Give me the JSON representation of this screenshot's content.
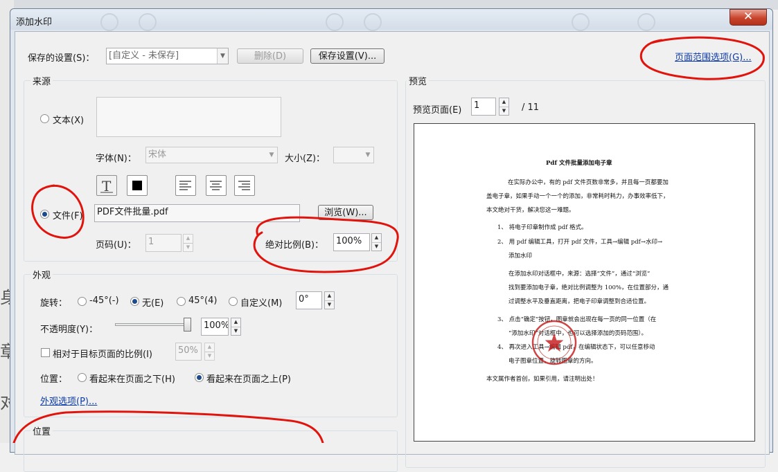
{
  "window": {
    "title": "添加水印",
    "close_label": "✕"
  },
  "background_chars": [
    "身",
    "章",
    "对"
  ],
  "saved_settings": {
    "label": "保存的设置(S)：",
    "value": "[自定义 - 未保存]",
    "delete_label": "删除(D)",
    "save_label": "保存设置(V)..."
  },
  "page_range_link": "页面范围选项(G)...",
  "source": {
    "group_title": "来源",
    "text_radio_label": "文本(X)",
    "text_value": "",
    "font_label": "字体(N)：",
    "font_value": "宋体",
    "size_label": "大小(Z)：",
    "size_value": "",
    "file_radio_label": "文件(F)",
    "file_value": "PDF文件批量.pdf",
    "browse_label": "浏览(W)...",
    "page_label": "页码(U)：",
    "page_value": "1",
    "scale_label": "绝对比例(B)：",
    "scale_value": "100%",
    "selected": "file"
  },
  "appearance": {
    "group_title": "外观",
    "rotation_label": "旋转：",
    "rot_options": [
      "-45°(-)",
      "无(E)",
      "45°(4)",
      "自定义(M)"
    ],
    "rot_selected": 1,
    "rot_custom_value": "0°",
    "opacity_label": "不透明度(Y)：",
    "opacity_value": "100%",
    "opacity_fraction": 1.0,
    "relative_label": "相对于目标页面的比例(I)",
    "relative_value": "50%",
    "relative_checked": false,
    "position_label": "位置：",
    "pos_options": [
      "看起来在页面之下(H)",
      "看起来在页面之上(P)"
    ],
    "pos_selected": 1,
    "link": "外观选项(P)..."
  },
  "position_group": {
    "group_title": "位置"
  },
  "preview": {
    "group_title": "预览",
    "page_label": "预览页面(E)",
    "page_value": "1",
    "page_total": "/ 11",
    "doc": {
      "title": "Pdf 文件批量添加电子章",
      "lines": [
        "在实际办公中，有的 pdf 文件页数非常多，并且每一页都要加",
        "盖电子章，如果手动一个一个的添加，非常耗时耗力，办事效率低下，",
        "本文绝对干货，解决您这一难题。",
        "1、    将电子印章制作成 pdf 格式。",
        "2、    用 pdf 编辑工具，打开 pdf 文件，工具→编辑 pdf→水印→",
        "添加水印",
        "在添加水印对话框中，来源：选择“文件”，通过“浏览”",
        "找到要添加电子章，绝对比例调整为 100%，在位置部分，通",
        "过调整水平及垂直距离，把电子印章调整到合适位置。",
        "3、    点击“确定”按钮，图章就会出现在每一页的同一位置（在",
        "“添加水印”对话框中，也可以选择添加的页码范围）。",
        "4、    再次进入工具→编辑 pdf，在编辑状态下，可以任意移动",
        "电子图章位置，旋转图章的方向。",
        "本文属作者首创，如果引用，请注明出处！"
      ]
    }
  },
  "colors": {
    "annotation": "#e0140c",
    "link": "#0b3aa8",
    "stamp": "#c41616"
  }
}
